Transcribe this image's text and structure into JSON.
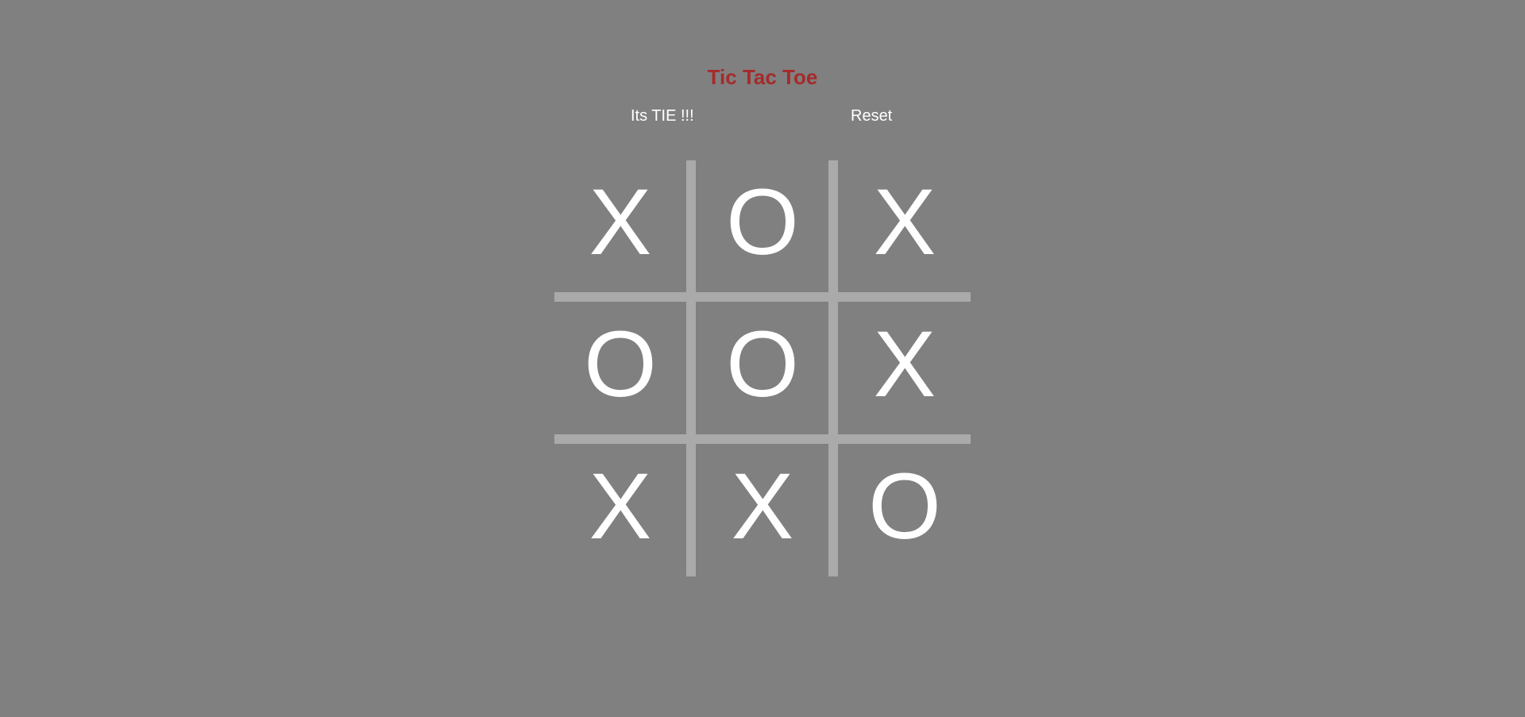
{
  "title": "Tic Tac Toe",
  "status": "Its TIE !!!",
  "reset_label": "Reset",
  "board": {
    "cells": [
      "X",
      "O",
      "X",
      "O",
      "O",
      "X",
      "X",
      "X",
      "O"
    ]
  },
  "colors": {
    "background": "#808080",
    "title": "#a52a2a",
    "text": "#ffffff",
    "grid": "#aaaaaa"
  }
}
